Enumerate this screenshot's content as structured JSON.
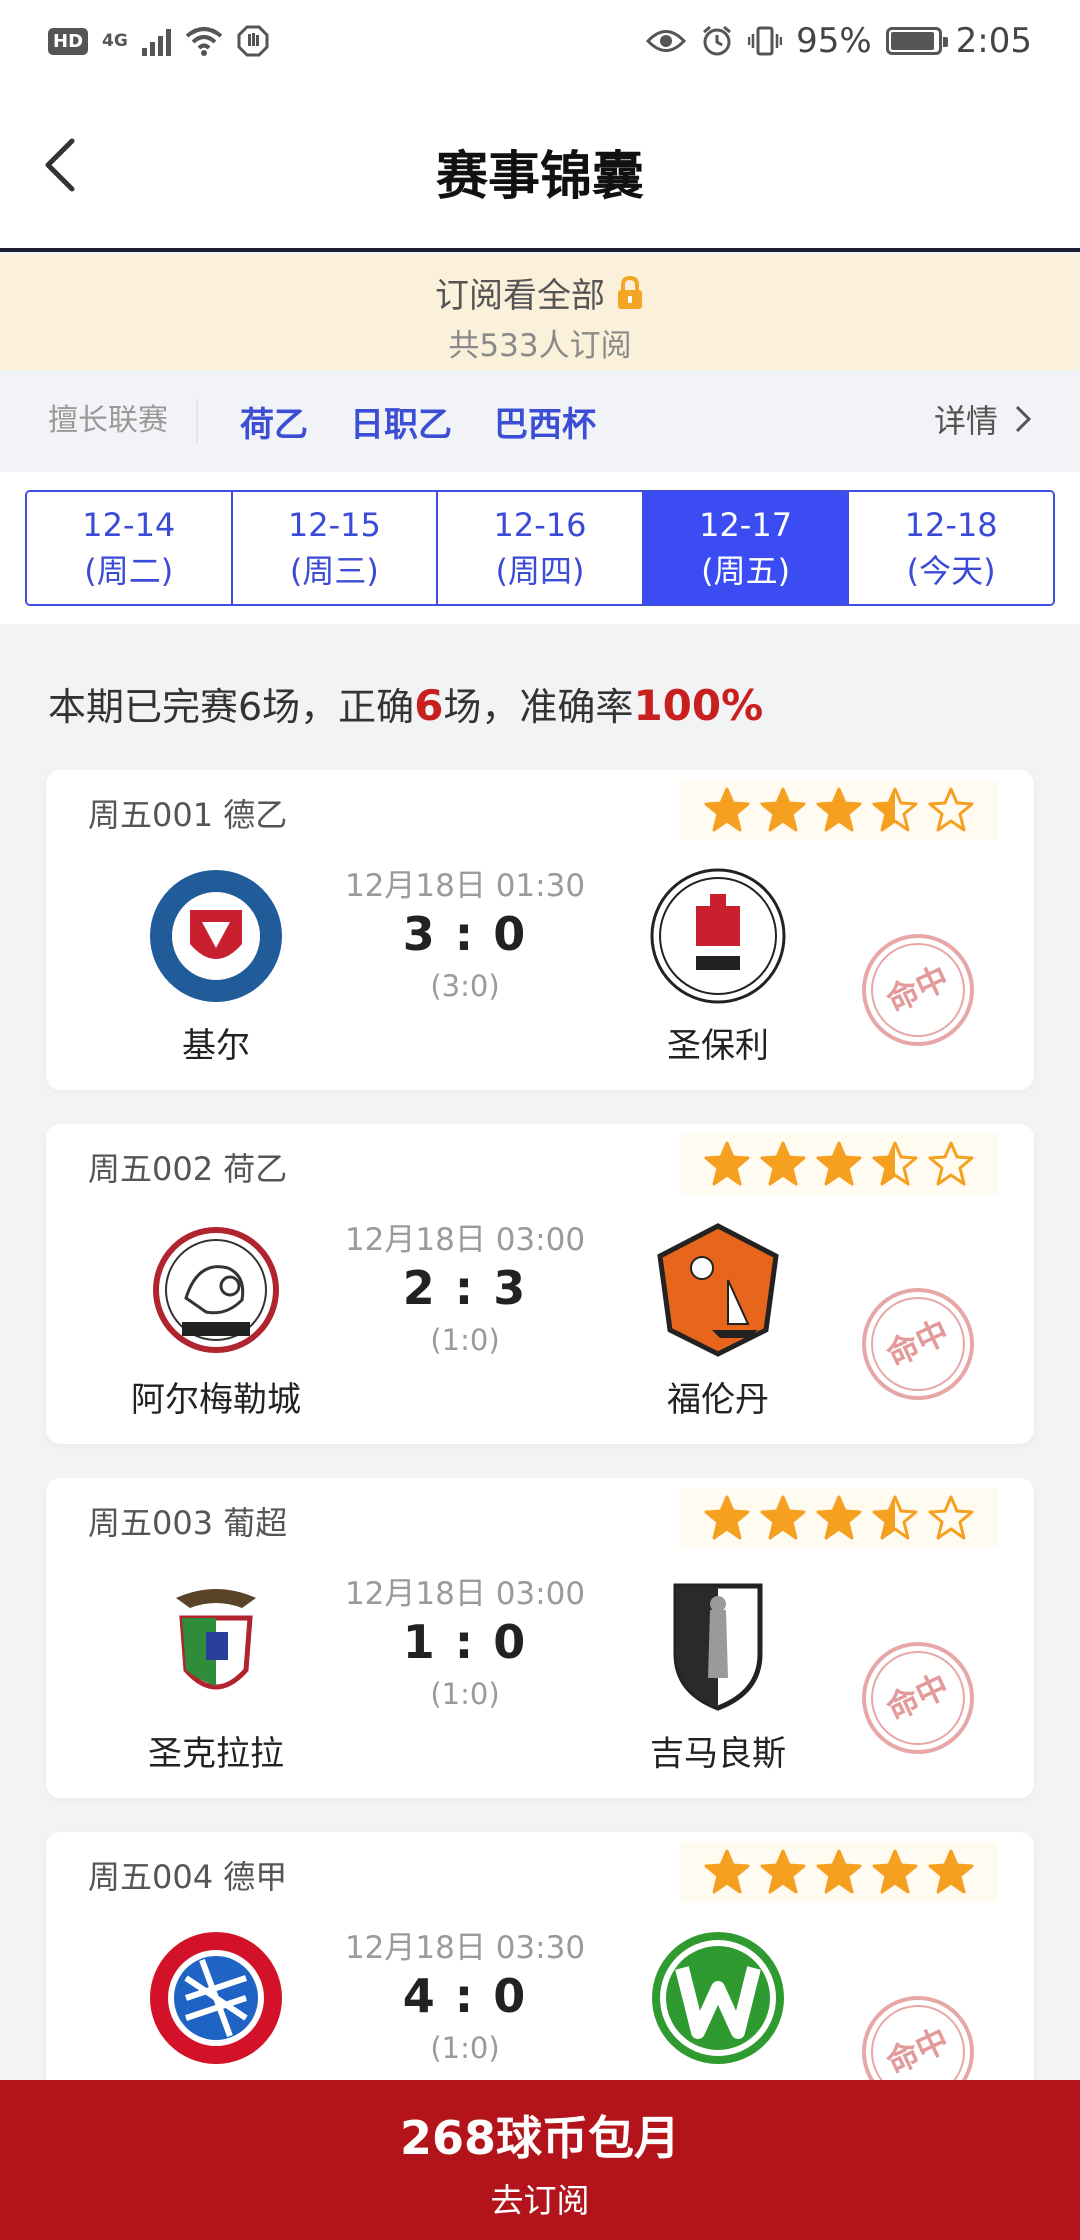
{
  "status_bar": {
    "network": "4G",
    "hd": "HD",
    "battery": "95%",
    "battery_level": 0.95,
    "time": "2:05"
  },
  "nav": {
    "back_icon": "chevron-left-icon",
    "title": "赛事锦囊"
  },
  "subscribe": {
    "label": "订阅看全部",
    "lock_icon": "lock-icon",
    "count_text": "共533人订阅"
  },
  "leagues": {
    "label": "擅长联赛",
    "items": [
      "荷乙",
      "日职乙",
      "巴西杯"
    ],
    "detail": "详情"
  },
  "dates": [
    {
      "date": "12-14",
      "day": "(周二)",
      "active": false
    },
    {
      "date": "12-15",
      "day": "(周三)",
      "active": false
    },
    {
      "date": "12-16",
      "day": "(周四)",
      "active": false
    },
    {
      "date": "12-17",
      "day": "(周五)",
      "active": true
    },
    {
      "date": "12-18",
      "day": "(今天)",
      "active": false
    }
  ],
  "summary": {
    "prefix": "本期已完赛6场，正确",
    "correct": "6",
    "middle": "场，准确率",
    "accuracy": "100%"
  },
  "matches": [
    {
      "header": "周五001 德乙",
      "rating": 3.5,
      "time": "12月18日 01:30",
      "score": "3 : 0",
      "half": "(3:0)",
      "home": "基尔",
      "away": "圣保利",
      "stamp": "命中"
    },
    {
      "header": "周五002 荷乙",
      "rating": 3.5,
      "time": "12月18日 03:00",
      "score": "2 : 3",
      "half": "(1:0)",
      "home": "阿尔梅勒城",
      "away": "福伦丹",
      "stamp": "命中"
    },
    {
      "header": "周五003 葡超",
      "rating": 3.5,
      "time": "12月18日 03:00",
      "score": "1 : 0",
      "half": "(1:0)",
      "home": "圣克拉拉",
      "away": "吉马良斯",
      "stamp": "命中"
    },
    {
      "header": "周五004 德甲",
      "rating": 5,
      "time": "12月18日 03:30",
      "score": "4 : 0",
      "half": "(1:0)",
      "home": "",
      "away": "",
      "stamp": "命中"
    }
  ],
  "bottom": {
    "price": "268球币包月",
    "action": "去订阅"
  },
  "colors": {
    "accent_blue": "#3b4cf2",
    "star_orange": "#f6a021",
    "stamp_red": "#e7a7a7",
    "cta_red": "#b3141b"
  }
}
